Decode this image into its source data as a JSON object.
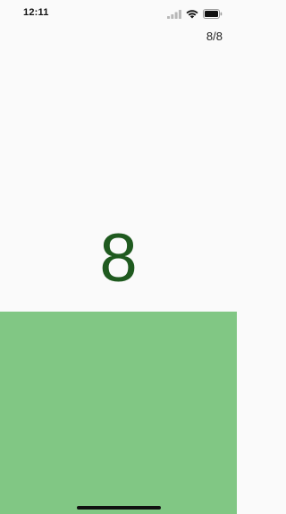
{
  "status_bar": {
    "time": "12:11",
    "icons": [
      "signal-icon",
      "wifi-icon",
      "battery-icon"
    ]
  },
  "header": {
    "counter": "8/8"
  },
  "card": {
    "value": "8",
    "colors": {
      "digit": "#1f5a1f",
      "top_background": "#fafafa",
      "bottom_background": "#81c784"
    }
  }
}
